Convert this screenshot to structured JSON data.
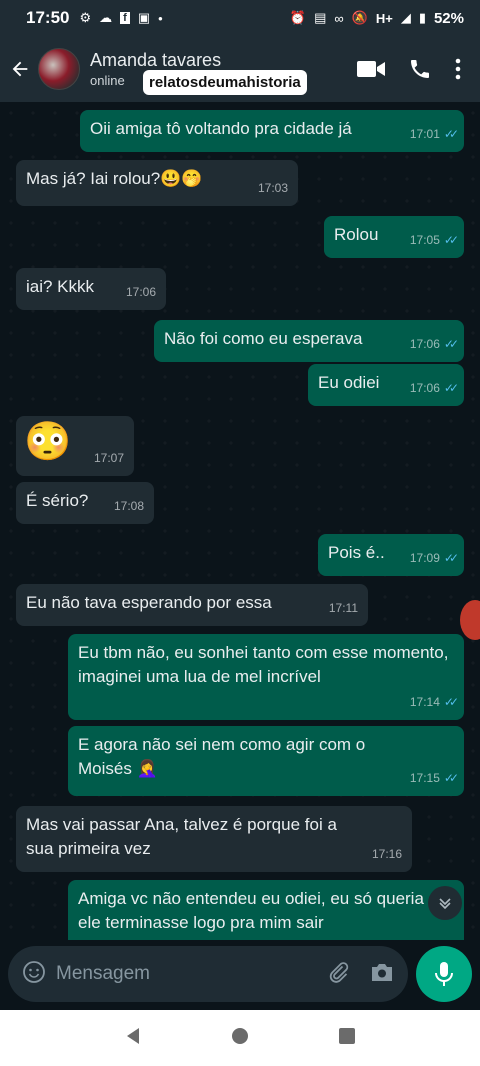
{
  "status_bar": {
    "time": "17:50",
    "left_icons": [
      "gear-icon",
      "cloud-icon",
      "facebook-icon",
      "android-icon",
      "dot-icon"
    ],
    "right_icons": [
      "alarm-icon",
      "cast-icon",
      "link-icon",
      "mute-icon",
      "signal-icon"
    ],
    "network": "H+",
    "battery": "52%"
  },
  "header": {
    "contact_name": "Amanda tavares",
    "contact_status": "online",
    "watermark": "relatosdeumahistoria"
  },
  "messages": [
    {
      "dir": "out",
      "text": "Oii amiga tô voltando pra cidade já",
      "time": "17:01"
    },
    {
      "dir": "in",
      "text": "Mas já? Iai rolou?😃🤭",
      "time": "17:03"
    },
    {
      "dir": "out",
      "text": "Rolou",
      "time": "17:05"
    },
    {
      "dir": "in",
      "text": "iai? Kkkk",
      "time": "17:06"
    },
    {
      "dir": "out",
      "text": "Não foi como eu esperava",
      "time": "17:06"
    },
    {
      "dir": "out",
      "text": "Eu odiei",
      "time": "17:06"
    },
    {
      "dir": "in",
      "text": "😳",
      "time": "17:07"
    },
    {
      "dir": "in",
      "text": "É sério?",
      "time": "17:08"
    },
    {
      "dir": "out",
      "text": "Pois é..",
      "time": "17:09"
    },
    {
      "dir": "in",
      "text": "Eu não tava esperando por essa",
      "time": "17:11"
    },
    {
      "dir": "out",
      "text": "Eu tbm não, eu sonhei tanto com esse momento, imaginei uma lua de mel incrível",
      "time": "17:14"
    },
    {
      "dir": "out",
      "text": "E agora não sei nem como agir com o Moisés 🤦‍♀️",
      "time": "17:15"
    },
    {
      "dir": "in",
      "text": "Mas vai passar Ana, talvez é porque foi a sua primeira vez",
      "time": "17:16"
    },
    {
      "dir": "out",
      "text": "Amiga vc não entendeu eu odiei, eu só queria que ele terminasse logo pra mim sair",
      "time": ""
    }
  ],
  "input": {
    "placeholder": "Mensagem"
  },
  "colors": {
    "outgoing_bubble": "#005c4b",
    "incoming_bubble": "#202c33",
    "accent": "#00a884",
    "read_ticks": "#53bdeb"
  }
}
